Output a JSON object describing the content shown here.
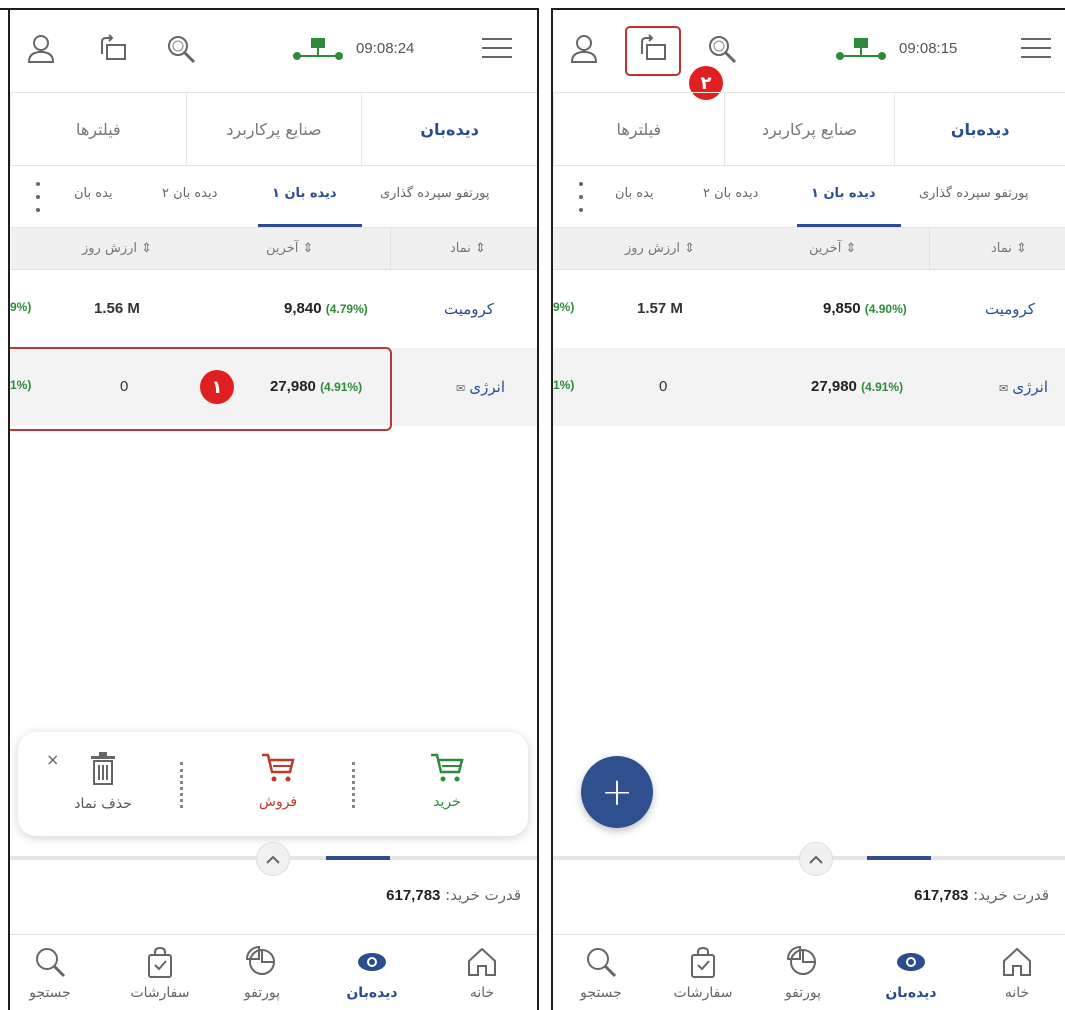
{
  "panels": [
    {
      "clock": "09:08:24",
      "tabs": [
        "دیده‌بان",
        "صنایع پرکاربرد",
        "فیلترها"
      ],
      "watchlists": [
        "پورتفو سپرده گذاری",
        "دیده بان ۱",
        "دیده بان ۲",
        "دیده بان"
      ],
      "columns": [
        "نماد",
        "آخرین",
        "ارزش روز"
      ],
      "rows": [
        {
          "symbol": "کرومیت",
          "last": "9,840",
          "change": "(4.79%)",
          "value": "1.56 M",
          "edge": "9%)"
        },
        {
          "symbol": "انرژی",
          "last": "27,980",
          "change": "(4.91%)",
          "value": "0",
          "edge": "1%)"
        }
      ],
      "step_badge": "۱",
      "actions": {
        "buy": "خرید",
        "sell": "فروش",
        "delete": "حذف نماد",
        "close": "×"
      },
      "power_label": "قدرت خرید:",
      "power_value": "617,783",
      "nav": [
        "خانه",
        "دیده‌بان",
        "پورتفو",
        "سفارشات",
        "جستجو"
      ]
    },
    {
      "clock": "09:08:15",
      "tabs": [
        "دیده‌بان",
        "صنایع پرکاربرد",
        "فیلترها"
      ],
      "watchlists": [
        "پورتفو سپرده گذاری",
        "دیده بان ۱",
        "دیده بان ۲",
        "دیده بان"
      ],
      "columns": [
        "نماد",
        "آخرین",
        "ارزش روز"
      ],
      "rows": [
        {
          "symbol": "کرومیت",
          "last": "9,850",
          "change": "(4.90%)",
          "value": "1.57 M",
          "edge": "9%)"
        },
        {
          "symbol": "انرژی",
          "last": "27,980",
          "change": "(4.91%)",
          "value": "0",
          "edge": "1%)"
        }
      ],
      "step_badge": "۲",
      "fab": "+",
      "power_label": "قدرت خرید:",
      "power_value": "617,783",
      "nav": [
        "خانه",
        "دیده‌بان",
        "پورتفو",
        "سفارشات",
        "جستجو"
      ]
    }
  ],
  "colors": {
    "brand": "#2a4d8f",
    "positive": "#2e8b3a",
    "sell": "#c0392b",
    "highlight": "#e02020"
  }
}
